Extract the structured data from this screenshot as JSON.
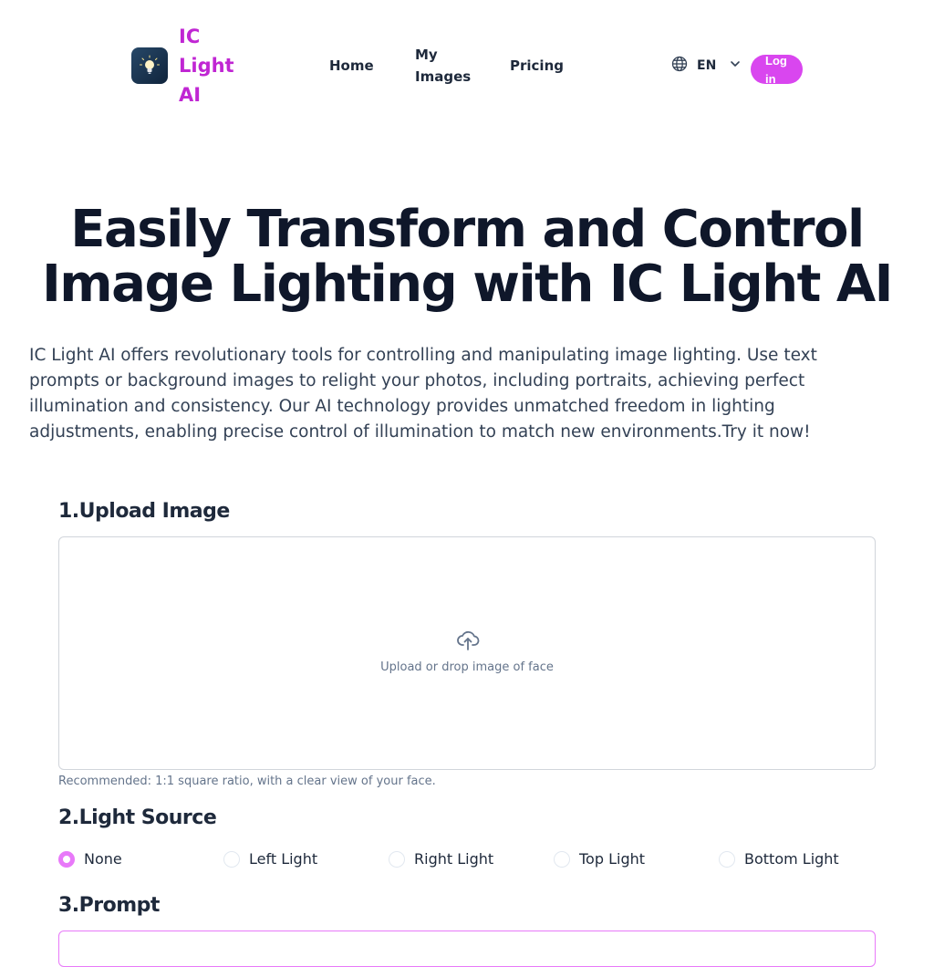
{
  "header": {
    "brand": "IC Light AI",
    "nav": [
      "Home",
      "My Images",
      "Pricing"
    ],
    "language": "EN",
    "login_label": "Log in"
  },
  "hero": {
    "title": "Easily Transform and Control Image Lighting with IC Light AI",
    "description": "IC Light AI offers revolutionary tools for controlling and manipulating image lighting. Use text prompts or background images to relight your photos, including portraits, achieving perfect illumination and consistency. Our AI technology provides unmatched freedom in lighting adjustments, enabling precise control of illumination to match new environments.Try it now!"
  },
  "upload": {
    "title": "1.Upload Image",
    "dropzone_text": "Upload or drop image of face",
    "hint": "Recommended: 1:1 square ratio, with a clear view of your face."
  },
  "light_source": {
    "title": "2.Light Source",
    "selected": "None",
    "options": [
      "None",
      "Left Light",
      "Right Light",
      "Top Light",
      "Bottom Light"
    ]
  },
  "prompt": {
    "title": "3.Prompt"
  },
  "colors": {
    "accent": "#d946ef",
    "brand_text": "#c026d3",
    "heading": "#0f172a"
  },
  "icons": {
    "logo": "lightbulb-icon",
    "language": "globe-icon",
    "dropdown": "chevron-down-icon",
    "upload": "cloud-upload-icon"
  }
}
